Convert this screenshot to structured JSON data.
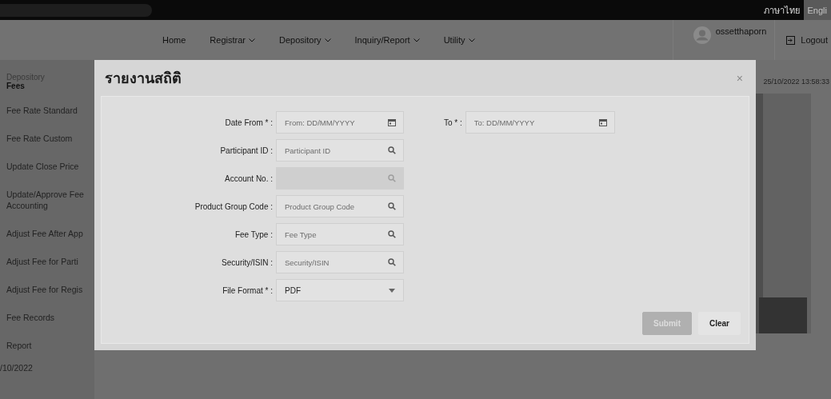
{
  "top_bar": {
    "languages": [
      {
        "label": "ภาษาไทย",
        "selected": true
      },
      {
        "label": "Engli",
        "selected": false
      }
    ]
  },
  "nav": {
    "items": [
      {
        "label": "Home",
        "dropdown": false
      },
      {
        "label": "Registrar",
        "dropdown": true
      },
      {
        "label": "Depository",
        "dropdown": true
      },
      {
        "label": "Inquiry/Report",
        "dropdown": true
      },
      {
        "label": "Utility",
        "dropdown": true
      }
    ],
    "user": "ossetthaporn",
    "logout": "Logout"
  },
  "sidebar": {
    "section": "Depository",
    "title": "Fees",
    "items": [
      "Fee Rate Standard",
      "Fee Rate Custom",
      "Update Close Price",
      "Update/Approve Fee\nAccounting",
      "Adjust Fee After App",
      "Adjust Fee for Parti",
      "Adjust Fee for Regis",
      "Fee Records",
      "Report"
    ],
    "footer_date": "/10/2022"
  },
  "timestamp": "25/10/2022 13:58:33",
  "modal": {
    "title": "รายงานสถิติ",
    "close": "×",
    "fields": [
      {
        "label": "Date From * :",
        "kind": "date",
        "placeholder": "From: DD/MM/YYYY",
        "disabled": false
      },
      {
        "label": "Participant ID :",
        "kind": "search",
        "placeholder": "Participant ID",
        "disabled": false
      },
      {
        "label": "Account No. :",
        "kind": "search",
        "disabled": true
      },
      {
        "label": "Product Group Code :",
        "kind": "search",
        "placeholder": "Product Group Code",
        "disabled": false
      },
      {
        "label": "Fee Type :",
        "kind": "search",
        "placeholder": "Fee Type",
        "disabled": false
      },
      {
        "label": "Security/ISIN :",
        "kind": "search",
        "placeholder": "Security/ISIN",
        "disabled": false
      },
      {
        "label": "File Format * :",
        "kind": "select",
        "value": "PDF",
        "disabled": false
      }
    ],
    "to_field": {
      "label": "To * :",
      "kind": "date",
      "placeholder": "To: DD/MM/YYYY",
      "disabled": false
    },
    "buttons": [
      {
        "label": "Submit",
        "disabled": true
      },
      {
        "label": "Clear",
        "disabled": false
      }
    ]
  }
}
